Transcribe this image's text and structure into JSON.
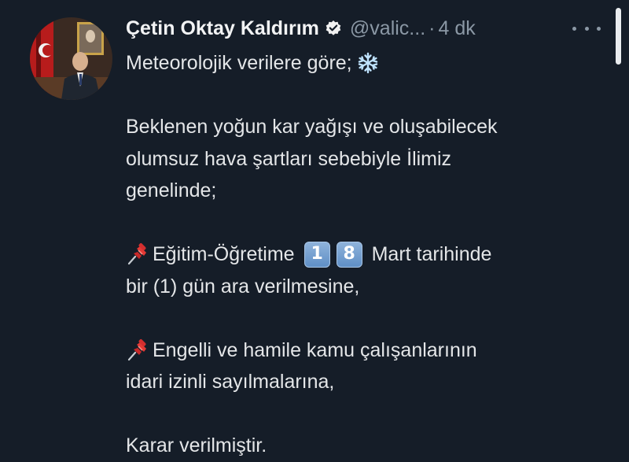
{
  "tweet": {
    "author_name": "Çetin Oktay Kaldırım",
    "handle": "@valic...",
    "separator": "·",
    "time": "4 dk",
    "lines": [
      "Meteorolojik verilere göre;",
      "Beklenen yoğun kar yağışı ve oluşabilecek",
      "olumsuz hava şartları sebebiyle İlimiz",
      "genelinde;",
      "Eğitim-Öğretime",
      "Mart tarihinde",
      "bir (1) gün ara verilmesine,",
      "Engelli ve hamile kamu çalışanlarının",
      "idari izinli sayılmalarına,",
      "Karar verilmiştir."
    ],
    "keycap_digits": [
      "1",
      "8"
    ],
    "icons": {
      "verified": "verified-badge-icon",
      "more": "more-options-icon",
      "snowflake": "snowflake-emoji",
      "pin": "pushpin-emoji"
    },
    "colors": {
      "background": "#151d28",
      "text": "#e4e6e8",
      "secondary": "#8b98a5",
      "keycap": "#6f9bd0"
    }
  }
}
